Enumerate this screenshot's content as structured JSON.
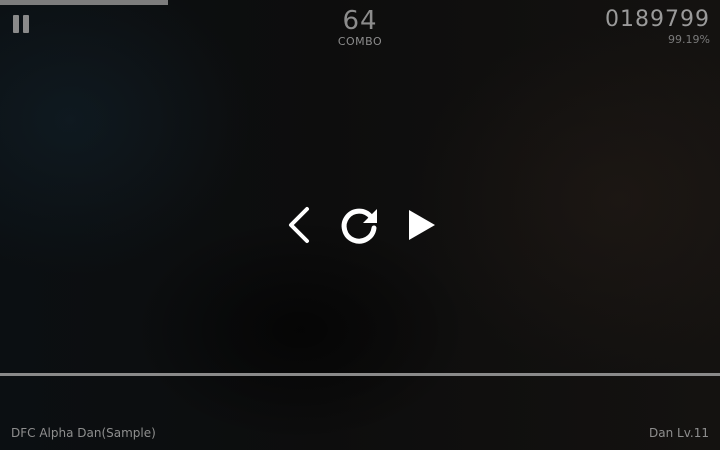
{
  "progress": {
    "fraction": 0.234
  },
  "hud": {
    "combo_value": "64",
    "combo_label": "COMBO",
    "score_value": "0189799",
    "accuracy": "99.19%"
  },
  "controls": {
    "back_icon": "chevron-left-icon",
    "retry_icon": "retry-icon",
    "play_icon": "play-icon"
  },
  "footer": {
    "song_title": "DFC Alpha Dan(Sample)",
    "level": "Dan Lv.11"
  },
  "colors": {
    "icons": "#ffffff",
    "hud_text": "#8c8c8c",
    "divider": "#8a8a8a"
  }
}
